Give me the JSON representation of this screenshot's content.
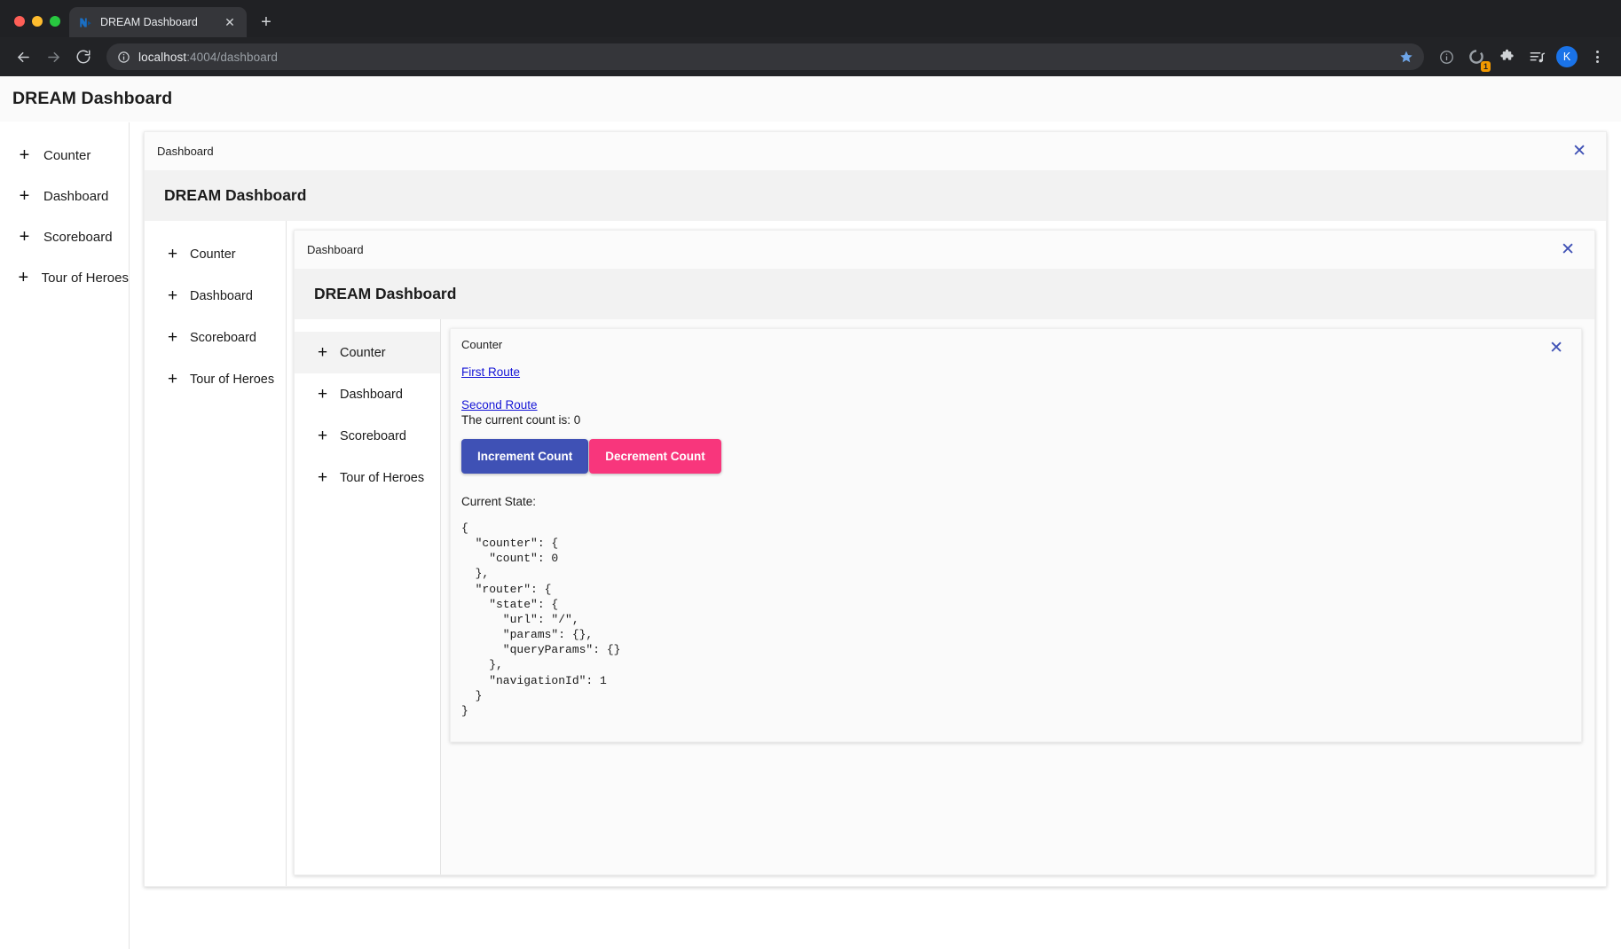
{
  "browser": {
    "tab": {
      "title": "DREAM Dashboard",
      "favicon_icon": "nx-logo-icon",
      "close_icon": "✕"
    },
    "newtab_icon": "+",
    "omnibox": {
      "info_icon": "ⓘ",
      "host": "localhost",
      "path": ":4004/dashboard",
      "full_url": "localhost:4004/dashboard",
      "star_icon": "star-icon"
    },
    "toolbar_icons": [
      {
        "name": "back-icon"
      },
      {
        "name": "forward-icon"
      },
      {
        "name": "reload-icon"
      },
      {
        "name": "page-info-icon"
      },
      {
        "name": "extension-loading-icon",
        "badge": "1"
      },
      {
        "name": "extensions-puzzle-icon"
      },
      {
        "name": "reading-list-icon"
      },
      {
        "name": "profile-avatar",
        "letter": "K"
      },
      {
        "name": "browser-menu-icon"
      }
    ]
  },
  "app": {
    "header_title": "DREAM Dashboard",
    "nav_plus": "+",
    "close_icon": "✕",
    "nav_items": [
      {
        "label": "Counter"
      },
      {
        "label": "Dashboard"
      },
      {
        "label": "Scoreboard"
      },
      {
        "label": "Tour of Heroes"
      }
    ]
  },
  "level1": {
    "topbar_label": "Dashboard",
    "banner_title": "DREAM Dashboard",
    "nav_items": [
      {
        "label": "Counter"
      },
      {
        "label": "Dashboard"
      },
      {
        "label": "Scoreboard"
      },
      {
        "label": "Tour of Heroes"
      }
    ]
  },
  "level2": {
    "topbar_label": "Dashboard",
    "banner_title": "DREAM Dashboard",
    "nav_items": [
      {
        "label": "Counter",
        "active": true
      },
      {
        "label": "Dashboard"
      },
      {
        "label": "Scoreboard"
      },
      {
        "label": "Tour of Heroes"
      }
    ]
  },
  "counter": {
    "topbar_label": "Counter",
    "first_route_link": "First Route",
    "second_route_link": "Second Route",
    "count_text": "The current count is: 0",
    "count_value": 0,
    "increment_label": "Increment Count",
    "decrement_label": "Decrement Count",
    "increment_color": "#3f51b5",
    "decrement_color": "#f8367c",
    "state_label": "Current State:",
    "state_json": "{\n  \"counter\": {\n    \"count\": 0\n  },\n  \"router\": {\n    \"state\": {\n      \"url\": \"/\",\n      \"params\": {},\n      \"queryParams\": {}\n    },\n    \"navigationId\": 1\n  }\n}"
  }
}
